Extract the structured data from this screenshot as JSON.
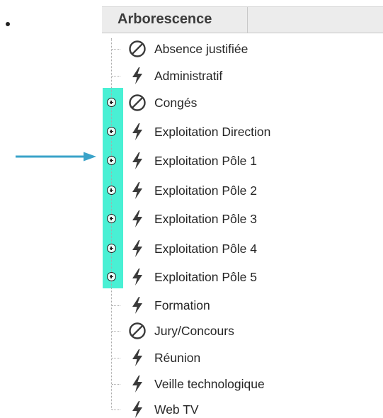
{
  "header": {
    "title": "Arborescence"
  },
  "colors": {
    "highlight": "#49f0d4",
    "arrow": "#3aa3c9",
    "header_bg": "#ececec",
    "text": "#262626"
  },
  "tree": {
    "items": [
      {
        "label": "Absence justifiée",
        "icon": "no-entry-icon",
        "expandable": false
      },
      {
        "label": "Administratif",
        "icon": "lightning-icon",
        "expandable": false
      },
      {
        "label": "Congés",
        "icon": "no-entry-icon",
        "expandable": true
      },
      {
        "label": "Exploitation Direction",
        "icon": "lightning-icon",
        "expandable": true
      },
      {
        "label": "Exploitation Pôle 1",
        "icon": "lightning-icon",
        "expandable": true
      },
      {
        "label": "Exploitation Pôle 2",
        "icon": "lightning-icon",
        "expandable": true
      },
      {
        "label": "Exploitation Pôle 3",
        "icon": "lightning-icon",
        "expandable": true
      },
      {
        "label": "Exploitation Pôle 4",
        "icon": "lightning-icon",
        "expandable": true
      },
      {
        "label": "Exploitation Pôle 5",
        "icon": "lightning-icon",
        "expandable": true
      },
      {
        "label": "Formation",
        "icon": "lightning-icon",
        "expandable": false
      },
      {
        "label": "Jury/Concours",
        "icon": "no-entry-icon",
        "expandable": false
      },
      {
        "label": "Réunion",
        "icon": "lightning-icon",
        "expandable": false
      },
      {
        "label": "Veille technologique",
        "icon": "lightning-icon",
        "expandable": false
      },
      {
        "label": "Web TV",
        "icon": "lightning-icon",
        "expandable": false
      }
    ]
  }
}
